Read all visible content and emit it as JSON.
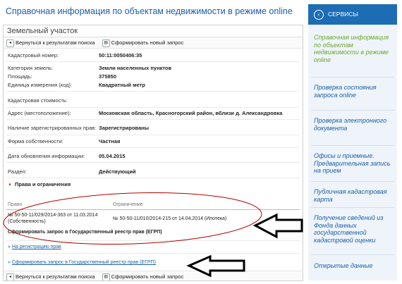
{
  "page_title": "Справочная информация по объектам недвижимости в режиме online",
  "card_title": "Земельный участок",
  "toolbar": {
    "back_label": "Вернуться к результатам поиска",
    "new_label": "Сформировать новый запрос"
  },
  "fields": [
    {
      "label": "Кадастровый номер:",
      "value": "50:11:0050406:35"
    },
    {
      "label": "Категория земель:",
      "value": "Земли населенных пунктов"
    },
    {
      "label": "Площадь:",
      "value": "375850"
    },
    {
      "label": "Единица измерения (код):",
      "value": "Квадратный метр"
    },
    {
      "label": "Кадастровая стоимость:",
      "value": ""
    },
    {
      "label": "Адрес (местоположение):",
      "value": "Московская область, Красногорский район, вблизи д. Александровка"
    },
    {
      "label": "Наличие зарегистрированных прав:",
      "value": "Зарегистрированы"
    },
    {
      "label": "Форма собственности:",
      "value": "Частная"
    },
    {
      "label": "Дата обновления информации:",
      "value": "05.04.2015"
    },
    {
      "label": "Раздел:",
      "value": "Действующий"
    }
  ],
  "rights": {
    "section_title": "Права и ограничения",
    "col_right": "Право",
    "col_restriction": "Ограничение",
    "right_line1": "№ 50-50-11/029/2014-363   от 11.03.2014",
    "right_line2": "(Собственность)",
    "restriction": "№ 50-50-11/010/2014-215   от 14.04.2014  (Ипотека)",
    "egrp_request": "Сформировать запрос в Государственный реестр прав (ЕГРП)",
    "registration_link": "На регистрацию прав",
    "egrp_link": "Сформировать запрос в Государственный реестр прав (ЕГРП)"
  },
  "sidebar": {
    "header": "СЕРВИСЫ",
    "items": [
      {
        "label": "Справочная информация по объектам недвижимости в режиме online"
      },
      {
        "label": "Проверка состояния запроса online"
      },
      {
        "label": "Проверка электронного документа"
      },
      {
        "label": "Офисы и приемные. Предварительная запись на прием"
      },
      {
        "label": "Публичная кадастровая карта"
      },
      {
        "label": "Получение сведений из Фонда данных государственной кадастровой оценки"
      },
      {
        "label": "Открытые данные"
      }
    ]
  },
  "colors": {
    "accent": "#1d6db5",
    "active_item": "#6aa72c",
    "annotation": "#b00000"
  }
}
